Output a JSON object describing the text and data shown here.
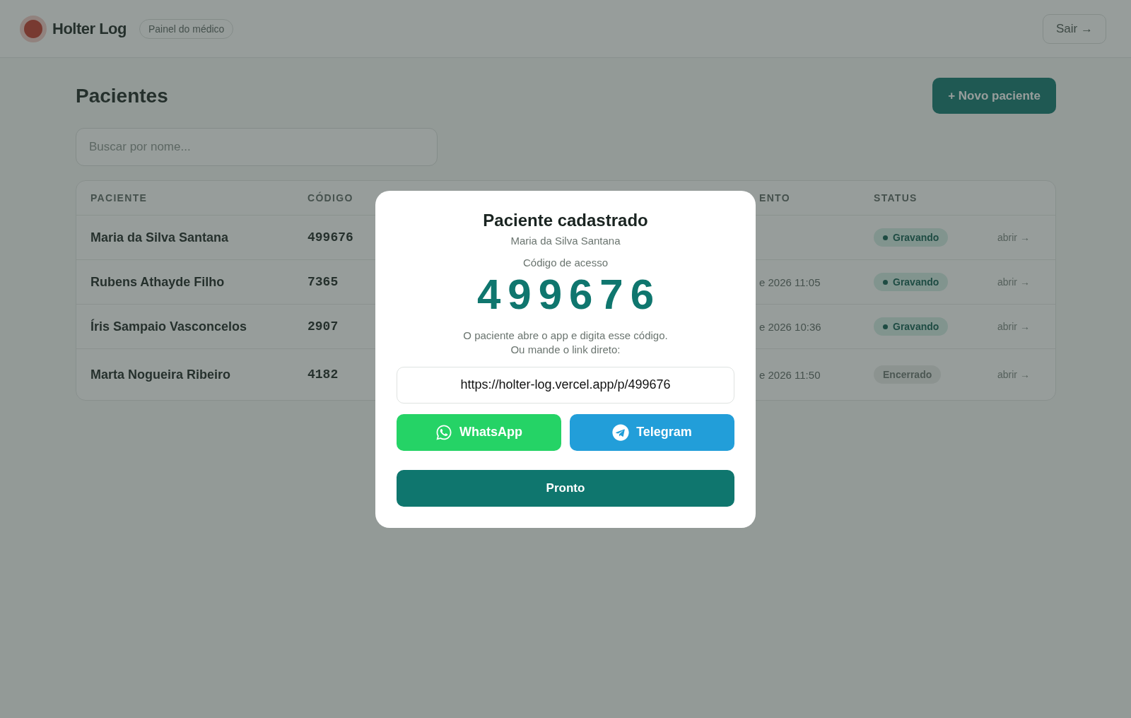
{
  "header": {
    "logo": "Holter Log",
    "badge": "Painel do médico",
    "logout": "Sair →"
  },
  "page": {
    "title": "Pacientes",
    "new_button": "+ Novo paciente",
    "search": {
      "placeholder": "Buscar por nome..."
    }
  },
  "table": {
    "columns": [
      {
        "label": "PACIENTE"
      },
      {
        "label": "CÓDIGO"
      },
      {
        "label": "ENTO"
      },
      {
        "label": "STATUS"
      }
    ],
    "rows": [
      {
        "patient": "Maria da Silva Santana",
        "code": "499676",
        "status": {
          "label": "Gravando",
          "kind": "recording"
        },
        "action": "abrir →"
      },
      {
        "patient": "Rubens Athayde Filho",
        "code": "7365",
        "column_3": "e 2026 11:05",
        "status": {
          "label": "Gravando",
          "kind": "recording"
        },
        "action": "abrir →"
      },
      {
        "patient": "Íris Sampaio Vasconcelos",
        "code": "2907",
        "column_3": "e 2026 10:36",
        "status": {
          "label": "Gravando",
          "kind": "recording"
        },
        "action": "abrir →"
      },
      {
        "patient": "Marta Nogueira Ribeiro",
        "code": "4182",
        "column_3": "e 2026 11:50",
        "status": {
          "label": "Encerrado",
          "kind": "ended"
        },
        "action": "abrir →"
      }
    ]
  },
  "modal": {
    "title": "Paciente cadastrado",
    "patient": "Maria da Silva Santana",
    "code_label": "Código de acesso",
    "code": "499676",
    "instructions": [
      "O paciente abre o app e digita esse código.",
      "Ou mande o link direto:"
    ],
    "link": "https://holter-log.vercel.app/p/499676",
    "share_buttons": [
      {
        "label": "WhatsApp",
        "kind": "whatsapp"
      },
      {
        "label": "Telegram",
        "kind": "telegram"
      }
    ],
    "done": "Pronto"
  }
}
